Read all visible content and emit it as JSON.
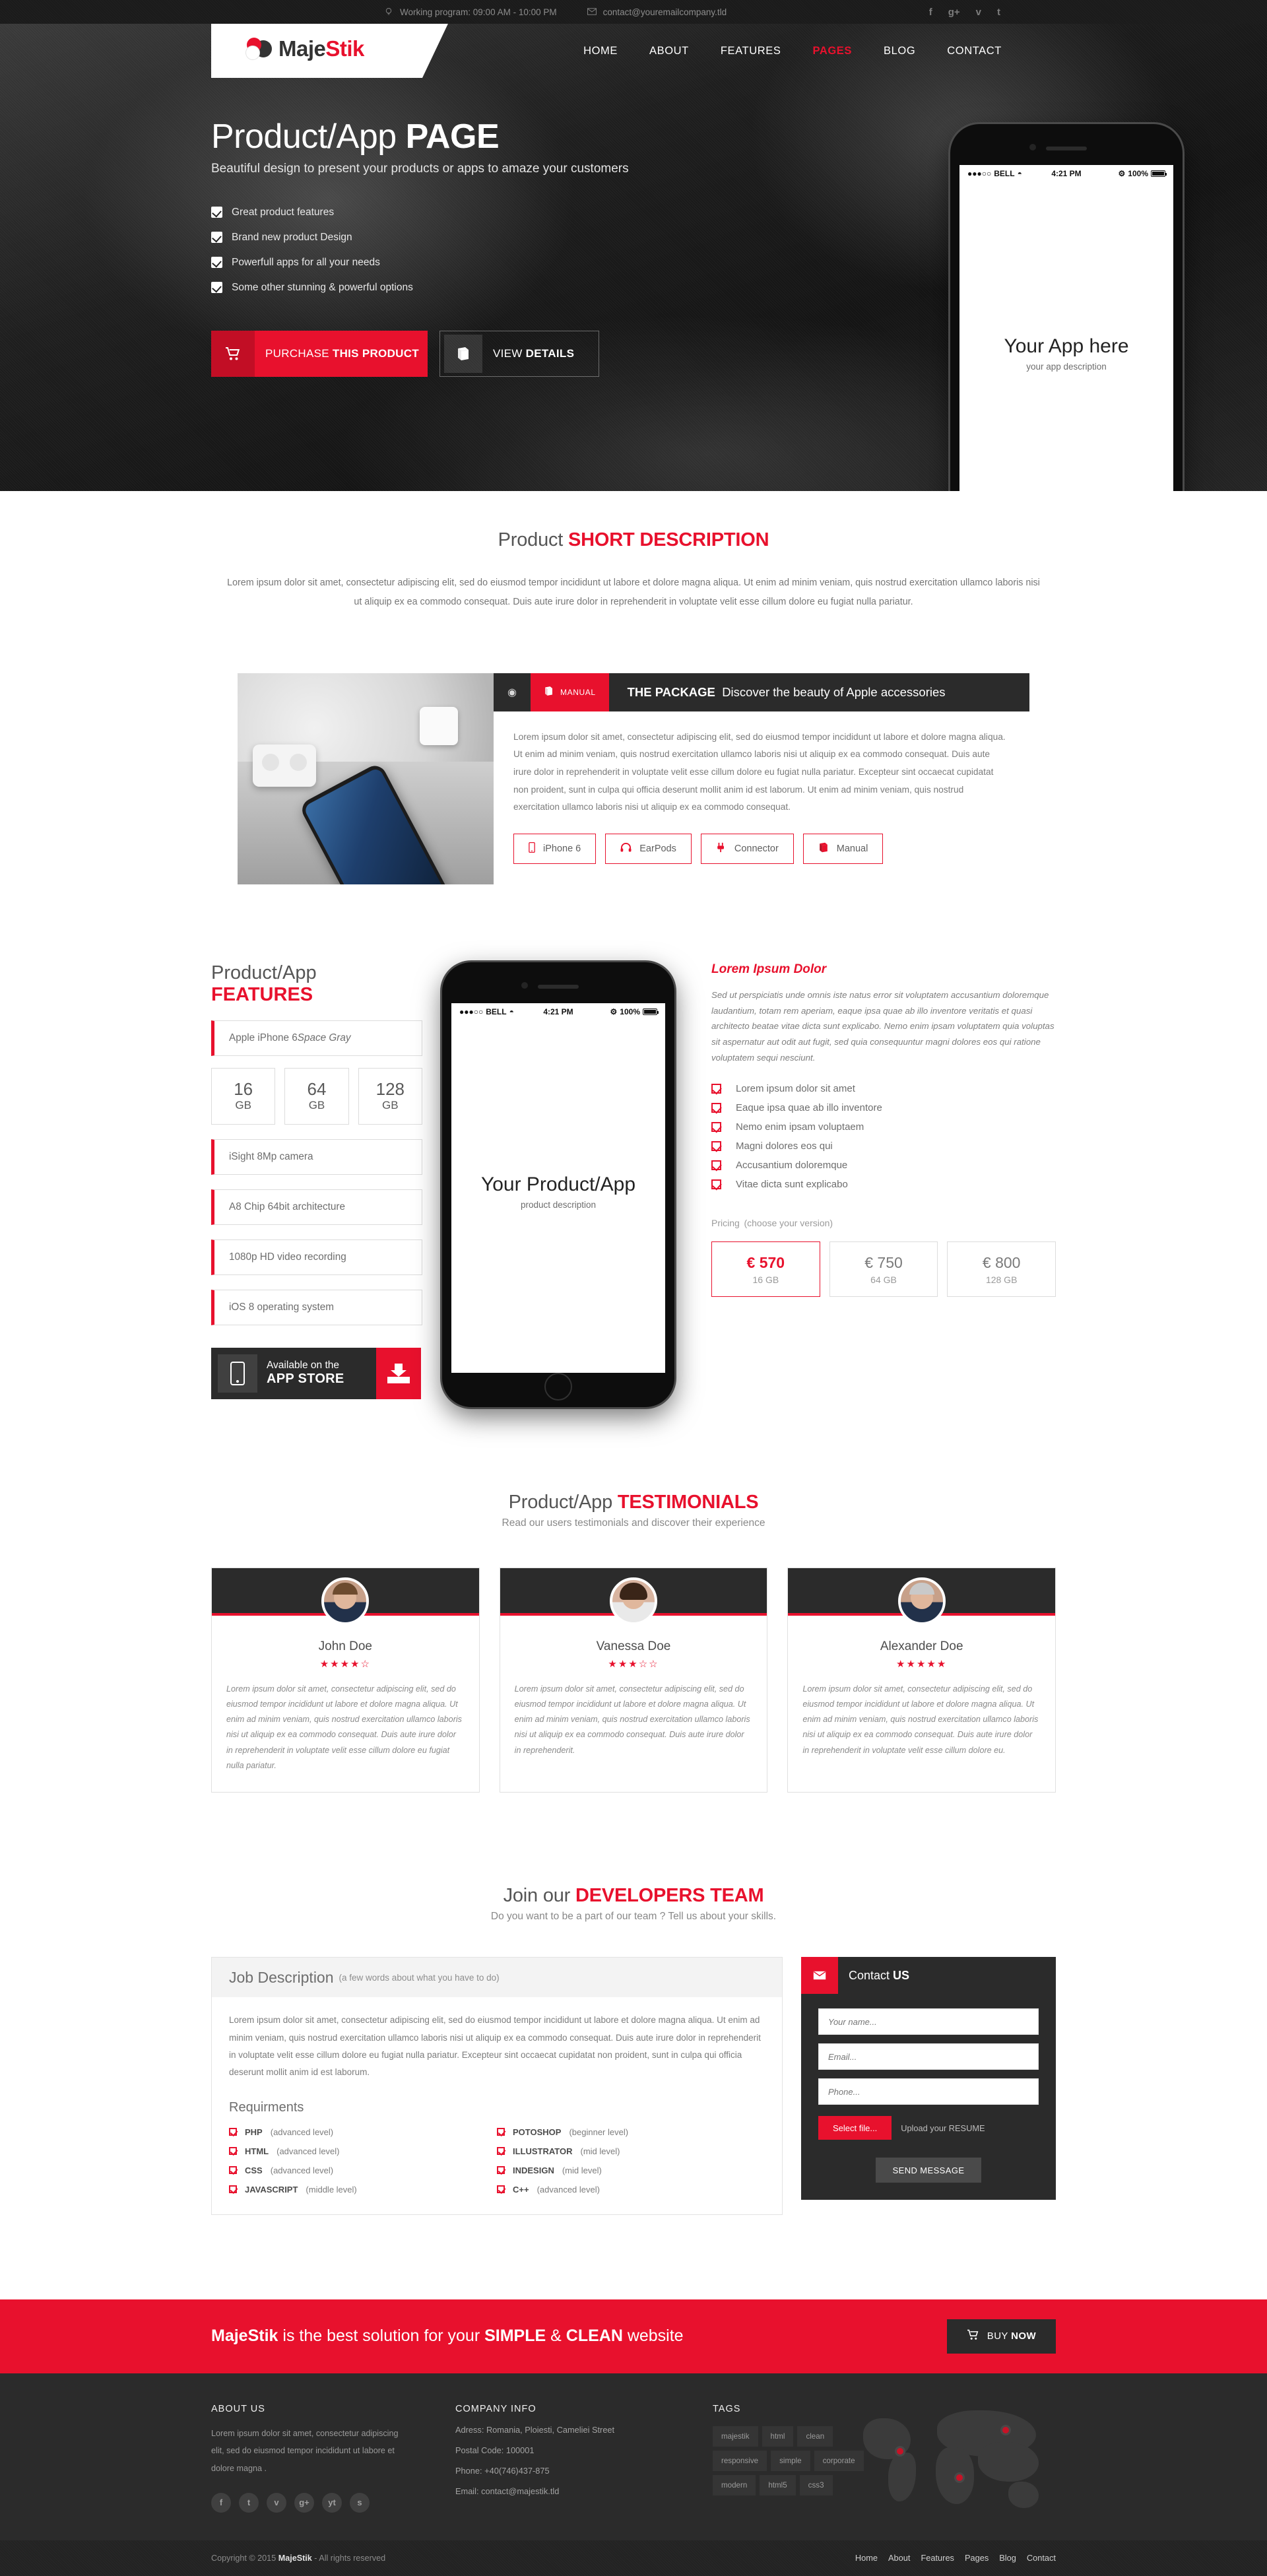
{
  "topbar": {
    "working_program": "Working program: 09:00 AM - 10:00 PM",
    "email": "contact@youremailcompany.tld",
    "social": [
      "f",
      "g+",
      "v",
      "t"
    ]
  },
  "header": {
    "logo_part1": "Maje",
    "logo_part2": "Stik",
    "nav": [
      {
        "label": "HOME",
        "active": false
      },
      {
        "label": "ABOUT",
        "active": false
      },
      {
        "label": "FEATURES",
        "active": false
      },
      {
        "label": "PAGES",
        "active": true
      },
      {
        "label": "BLOG",
        "active": false
      },
      {
        "label": "CONTACT",
        "active": false
      }
    ]
  },
  "hero": {
    "title_light": "Product/App ",
    "title_bold": "PAGE",
    "subtitle": "Beautiful design to present your products or apps to amaze your customers",
    "checklist": [
      "Great product features",
      "Brand new product Design",
      "Powerfull apps for all your needs",
      "Some other stunning & powerful options"
    ],
    "btn_purchase_light": "PURCHASE ",
    "btn_purchase_bold": "THIS PRODUCT",
    "btn_details_light": "VIEW ",
    "btn_details_bold": "DETAILS",
    "phone": {
      "carrier": "BELL",
      "time": "4:21 PM",
      "battery": "100%",
      "app_title": "Your App here",
      "app_desc": "your app description"
    }
  },
  "short_description": {
    "heading_light": "Product ",
    "heading_bold": "SHORT DESCRIPTION",
    "body": "Lorem ipsum dolor sit amet, consectetur adipiscing elit, sed do eiusmod tempor incididunt ut labore et dolore magna aliqua. Ut enim ad minim veniam, quis nostrud exercitation ullamco laboris nisi ut aliquip ex ea commodo consequat. Duis aute irure dolor in reprehenderit in voluptate velit esse cillum dolore eu fugiat nulla pariatur."
  },
  "package": {
    "manual_badge": "MANUAL",
    "title_bold": "THE PACKAGE",
    "title_light": "Discover the beauty of Apple accessories",
    "body": "Lorem ipsum dolor sit amet, consectetur adipiscing elit, sed do eiusmod tempor incididunt ut labore et dolore magna aliqua. Ut enim ad minim veniam, quis nostrud exercitation ullamco laboris nisi ut aliquip ex ea commodo consequat. Duis aute irure dolor in reprehenderit in voluptate velit esse cillum dolore eu fugiat nulla pariatur. Excepteur sint occaecat cupidatat non proident, sunt in culpa qui officia deserunt mollit anim id est laborum. Ut enim ad minim veniam, quis nostrud exercitation ullamco laboris nisi ut aliquip ex ea commodo consequat.",
    "tags": [
      {
        "label": "iPhone 6",
        "icon": "phone-icon"
      },
      {
        "label": "EarPods",
        "icon": "headphones-icon"
      },
      {
        "label": "Connector",
        "icon": "plug-icon"
      },
      {
        "label": "Manual",
        "icon": "book-icon"
      }
    ]
  },
  "features": {
    "title_light": "Product/App ",
    "title_bold": "FEATURES",
    "model_name": "Apple iPhone 6 ",
    "model_variant": "Space Gray",
    "capacities": [
      {
        "n": "16",
        "u": "GB"
      },
      {
        "n": "64",
        "u": "GB"
      },
      {
        "n": "128",
        "u": "GB"
      }
    ],
    "specs": [
      "iSight 8Mp camera",
      "A8 Chip 64bit architecture",
      "1080p HD video recording",
      "iOS 8 operating system"
    ],
    "appstore_line1": "Available on the",
    "appstore_line2": "APP STORE",
    "phone": {
      "carrier": "BELL",
      "time": "4:21 PM",
      "battery": "100%",
      "app_title": "Your Product/App",
      "app_desc": "product description"
    },
    "right_title": "Lorem Ipsum Dolor",
    "right_paragraph": "Sed ut perspiciatis unde omnis iste natus error sit voluptatem accusantium doloremque laudantium, totam rem aperiam, eaque ipsa quae ab illo inventore veritatis et quasi architecto beatae vitae dicta sunt explicabo. Nemo enim ipsam voluptatem quia voluptas sit aspernatur aut odit aut fugit, sed quia consequuntur magni dolores eos qui ratione voluptatem sequi nesciunt.",
    "right_list": [
      "Lorem ipsum dolor sit amet",
      "Eaque ipsa quae ab illo inventore",
      "Nemo enim ipsam voluptaem",
      "Magni dolores eos qui",
      "Accusantium doloremque",
      "Vitae dicta sunt explicabo"
    ],
    "pricing_h": "Pricing",
    "pricing_sub": "(choose your version)",
    "prices": [
      {
        "value": "€ 570",
        "size": "16 GB",
        "selected": true
      },
      {
        "value": "€ 750",
        "size": "64 GB",
        "selected": false
      },
      {
        "value": "€ 800",
        "size": "128 GB",
        "selected": false
      }
    ]
  },
  "testimonials": {
    "title_light": "Product/App ",
    "title_bold": "TESTIMONIALS",
    "subtitle": "Read our users testimonials and discover their experience",
    "items": [
      {
        "name": "John Doe",
        "stars": "★★★★☆",
        "text": "Lorem ipsum dolor sit amet, consectetur adipiscing elit, sed do eiusmod tempor incididunt ut labore et dolore magna aliqua. Ut enim ad minim veniam, quis nostrud exercitation ullamco laboris nisi ut aliquip ex ea commodo consequat. Duis aute irure dolor in reprehenderit in voluptate velit esse cillum dolore eu fugiat nulla pariatur."
      },
      {
        "name": "Vanessa Doe",
        "stars": "★★★☆☆",
        "text": "Lorem ipsum dolor sit amet, consectetur adipiscing elit, sed do eiusmod tempor incididunt ut labore et dolore magna aliqua. Ut enim ad minim veniam, quis nostrud exercitation ullamco laboris nisi ut aliquip ex ea commodo consequat. Duis aute irure dolor in reprehenderit."
      },
      {
        "name": "Alexander Doe",
        "stars": "★★★★★",
        "text": "Lorem ipsum dolor sit amet, consectetur adipiscing elit, sed do eiusmod tempor incididunt ut labore et dolore magna aliqua. Ut enim ad minim veniam, quis nostrud exercitation ullamco laboris nisi ut aliquip ex ea commodo consequat. Duis aute irure dolor in reprehenderit in voluptate velit esse cillum dolore eu."
      }
    ]
  },
  "developers": {
    "title_light": "Join our ",
    "title_bold": "DEVELOPERS TEAM",
    "subtitle": "Do you want to be a part of our team ? Tell us about your skills.",
    "job_head": "Job Description",
    "job_head_sub": "(a few words about what you have to do)",
    "job_body": "Lorem ipsum dolor sit amet, consectetur adipiscing elit, sed do eiusmod tempor incididunt ut labore et dolore magna aliqua. Ut enim ad minim veniam, quis nostrud exercitation ullamco laboris nisi ut aliquip ex ea commodo consequat. Duis aute irure dolor in reprehenderit in voluptate velit esse cillum dolore eu fugiat nulla pariatur. Excepteur sint occaecat cupidatat non proident, sunt in culpa qui officia deserunt mollit anim id est laborum.",
    "req_heading": "Requirments",
    "requirements": [
      {
        "name": "PHP",
        "level": "(advanced level)"
      },
      {
        "name": "POTOSHOP",
        "level": "(beginner level)"
      },
      {
        "name": "HTML",
        "level": "(advanced level)"
      },
      {
        "name": "ILLUSTRATOR",
        "level": "(mid level)"
      },
      {
        "name": "CSS",
        "level": "(advanced level)"
      },
      {
        "name": "INDESIGN",
        "level": "(mid level)"
      },
      {
        "name": "JAVASCRIPT",
        "level": "(middle level)"
      },
      {
        "name": "C++",
        "level": "(advanced level)"
      }
    ],
    "contact_light": "Contact ",
    "contact_bold": "US",
    "form": {
      "name_placeholder": "Your name...",
      "email_placeholder": "Email...",
      "phone_placeholder": "Phone...",
      "select_file": "Select file...",
      "upload_label": "Upload your RESUME",
      "send": "SEND MESSAGE"
    }
  },
  "cta": {
    "brand": "MajeStik",
    "mid": " is the best solution for your ",
    "bold1": "SIMPLE",
    "amp": " & ",
    "bold2": "CLEAN",
    "tail": " website",
    "button_light": "BUY ",
    "button_bold": "NOW"
  },
  "footer": {
    "about_h": "ABOUT US",
    "about_p": "Lorem ipsum dolor sit amet, consectetur adipiscing elit, sed do eiusmod tempor incididunt ut labore et dolore magna .",
    "social": [
      "f",
      "t",
      "v",
      "g+",
      "yt",
      "s"
    ],
    "company_h": "COMPANY INFO",
    "company_lines": [
      "Adress: Romania, Ploiesti, Cameliei Street",
      "Postal Code: 100001",
      "Phone: +40(746)437-875",
      "Email: contact@majestik.tld"
    ],
    "tags_h": "TAGS",
    "tags": [
      "majestik",
      "html",
      "clean",
      "responsive",
      "simple",
      "corporate",
      "modern",
      "html5",
      "css3"
    ],
    "copyright_pre": "Copyright © 2015 ",
    "copyright_brand": "MajeStik",
    "copyright_post": " - All rights reserved",
    "nav": [
      "Home",
      "About",
      "Features",
      "Pages",
      "Blog",
      "Contact"
    ]
  }
}
